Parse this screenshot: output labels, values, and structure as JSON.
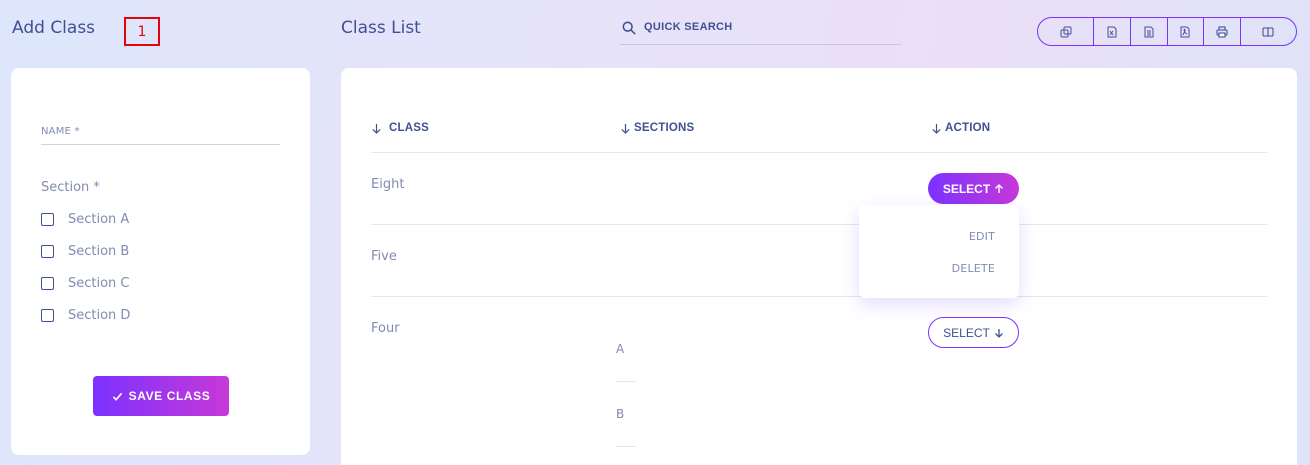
{
  "add_class": {
    "title": "Add Class",
    "badge": "1",
    "name_label": "NAME *",
    "section_label": "Section *",
    "sections": [
      "Section A",
      "Section B",
      "Section C",
      "Section D"
    ],
    "save_label": "SAVE CLASS",
    "save_icon": "check-icon"
  },
  "class_list": {
    "title": "Class List",
    "search_placeholder": "QUICK SEARCH",
    "toolbar_icons": [
      "copy-icon",
      "excel-icon",
      "csv-icon",
      "pdf-icon",
      "print-icon",
      "columns-icon"
    ],
    "columns": [
      "CLASS",
      "SECTIONS",
      "ACTION"
    ],
    "rows": [
      {
        "class": "Eight",
        "sections": []
      },
      {
        "class": "Five",
        "sections": []
      },
      {
        "class": "Four",
        "sections": [
          "A",
          "B"
        ]
      }
    ],
    "select_label": "SELECT",
    "dropdown": {
      "edit": "EDIT",
      "delete": "DELETE"
    }
  },
  "colors": {
    "primary": "#7c32ff",
    "gradient_end": "#c738d8",
    "text": "#415094",
    "muted": "#828bb2",
    "badge_red": "#e3050c"
  }
}
